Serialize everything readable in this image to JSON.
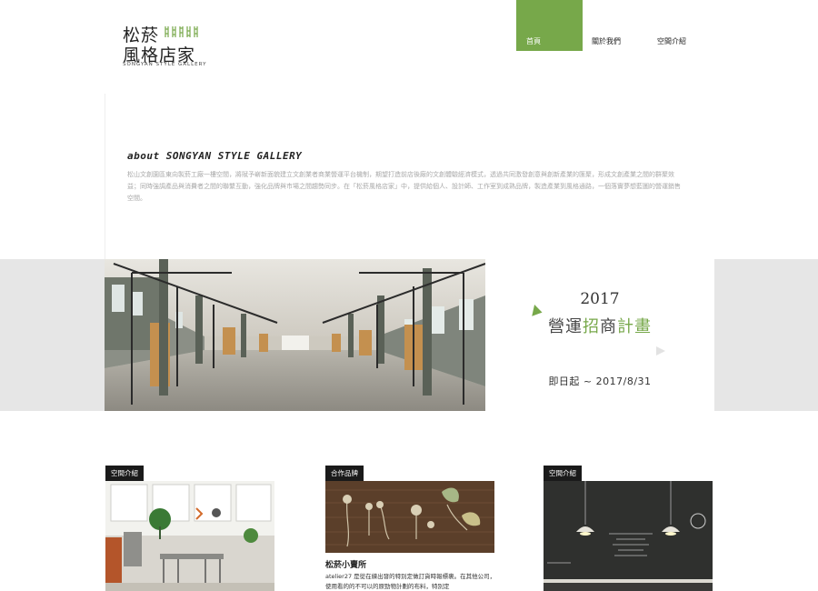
{
  "logo": {
    "line1": "松菸",
    "line2": "風格店家",
    "tagline": "SONGYAN STYLE GALLERY"
  },
  "nav": {
    "items": [
      {
        "label": "首頁",
        "active": true
      },
      {
        "label": "關於我們",
        "active": false
      },
      {
        "label": "空間介紹",
        "active": false
      }
    ]
  },
  "about": {
    "title": "about SONGYAN STYLE GALLERY",
    "text": "松山文創園區東向製菸工廠一樓空間，將賦予嶄新面貌建立文創業者商業營運平台機制，期望打造前店後廠的文創體驗經濟模式，透過共同激發創意與創新產業的匯聚，形成文創產業之間的群聚效益；同時強調產品與消費者之間的聯繫互動，強化品牌與市場之間趨勢同步。在「松菸風格店家」中，提供給個人、設計師、工作室到成熟品牌，製造產業到風格通路，一個落實夢想藍圖的營運銷售空間。"
  },
  "banner": {
    "year": "2017",
    "title_prefix": "營運",
    "title_highlight": "招",
    "title_middle": "商",
    "title_suffix": "計畫",
    "date": "即日起 ~ 2017/8/31"
  },
  "cards": [
    {
      "badge": "空間介紹"
    },
    {
      "badge": "合作品牌",
      "title": "松菸小賣所",
      "desc": "atelier27 是從在練出發的特別定做訂貨時報標裹。在其他公司，使用看的的不可以的原勁物計劃的布料，特別定"
    },
    {
      "badge": "空間介紹"
    }
  ],
  "colors": {
    "accent": "#77a84a",
    "badge": "#1a1a1a",
    "band": "#e6e6e6"
  }
}
